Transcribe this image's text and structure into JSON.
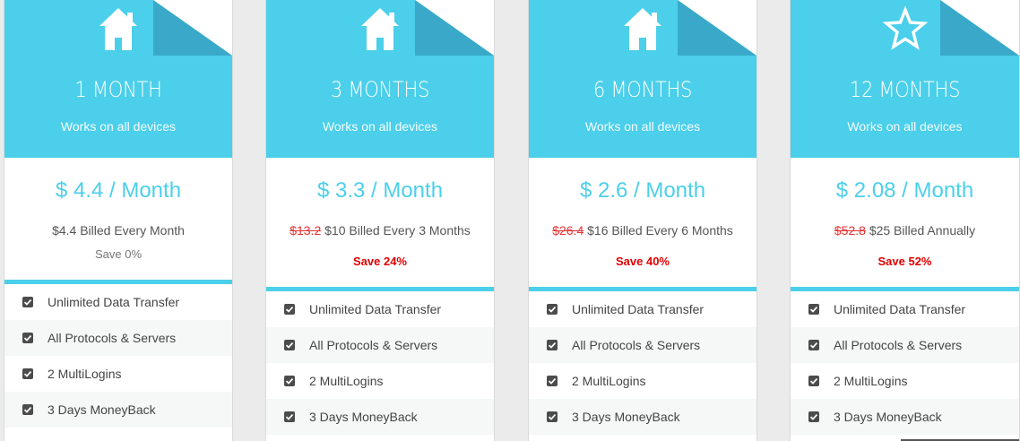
{
  "plans": [
    {
      "icon": "house-icon",
      "title": "1 MONTH",
      "subtitle": "Works on all devices",
      "price": "$ 4.4 / Month",
      "old_price": "",
      "billing": "$4.4 Billed Every Month",
      "save": "Save 0%",
      "features": [
        "Unlimited Data Transfer",
        "All Protocols & Servers",
        "2 MultiLogins",
        "3 Days MoneyBack"
      ]
    },
    {
      "icon": "house-icon",
      "title": "3 MONTHS",
      "subtitle": "Works on all devices",
      "price": "$ 3.3 / Month",
      "old_price": "$13.2",
      "billing": "$10 Billed Every 3 Months",
      "save": "Save 24%",
      "features": [
        "Unlimited Data Transfer",
        "All Protocols & Servers",
        "2 MultiLogins",
        "3 Days MoneyBack"
      ]
    },
    {
      "icon": "house-icon",
      "title": "6 MONTHS",
      "subtitle": "Works on all devices",
      "price": "$ 2.6 / Month",
      "old_price": "$26.4",
      "billing": "$16 Billed Every 6 Months",
      "save": "Save 40%",
      "features": [
        "Unlimited Data Transfer",
        "All Protocols & Servers",
        "2 MultiLogins",
        "3 Days MoneyBack"
      ]
    },
    {
      "icon": "star-icon",
      "title": "12 MONTHS",
      "subtitle": "Works on all devices",
      "price": "$ 2.08 / Month",
      "old_price": "$52.8",
      "billing": "$25 Billed Annually",
      "save": "Save 52%",
      "features": [
        "Unlimited Data Transfer",
        "All Protocols & Servers",
        "2 MultiLogins",
        "3 Days MoneyBack"
      ]
    }
  ],
  "colors": {
    "accent": "#4bcfea",
    "accent_dark": "#3aa9c9",
    "save_red": "#e00000",
    "strike_red": "#e83131"
  }
}
